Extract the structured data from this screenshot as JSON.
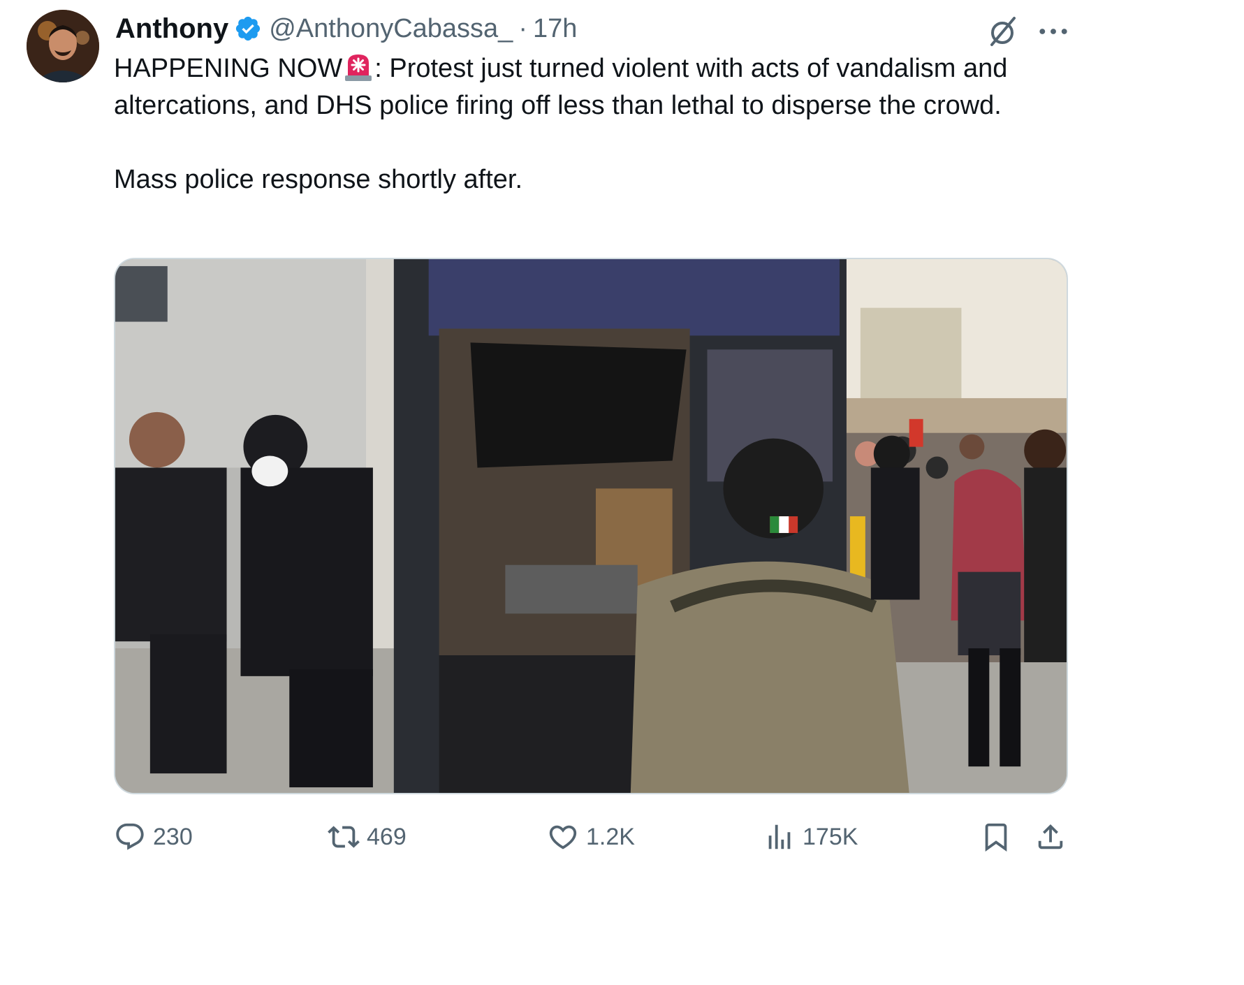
{
  "author": {
    "display_name": "Anthony",
    "handle": "@AnthonyCabassa_",
    "separator": "·",
    "time": "17h",
    "verified": true,
    "verified_color": "#1d9bf0"
  },
  "tweet": {
    "line1_prefix": "HAPPENING NOW",
    "emoji": "siren-icon",
    "line1_rest": ": Protest just turned violent with acts of vandalism and altercations, and DHS police firing off less than lethal to disperse the crowd.",
    "line2": "Mass police response shortly after."
  },
  "icons": {
    "grok": "grok-icon",
    "more": "more-icon"
  },
  "actions": {
    "reply": {
      "icon": "reply-icon",
      "count": "230"
    },
    "retweet": {
      "icon": "retweet-icon",
      "count": "469"
    },
    "like": {
      "icon": "heart-icon",
      "count": "1.2K"
    },
    "views": {
      "icon": "views-icon",
      "count": "175K"
    },
    "bookmark": {
      "icon": "bookmark-icon"
    },
    "share": {
      "icon": "share-icon"
    }
  },
  "colors": {
    "text_primary": "#0f1419",
    "text_secondary": "#536471",
    "border": "#cfd9de"
  }
}
